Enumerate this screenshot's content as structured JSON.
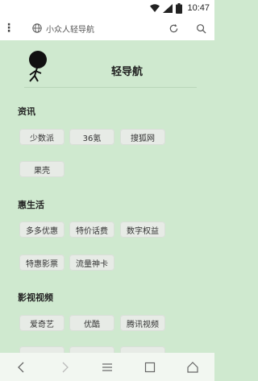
{
  "status_bar": {
    "time": "10:47"
  },
  "address_bar": {
    "url_text": "小众人轻导航"
  },
  "site": {
    "title": "轻导航"
  },
  "sections": [
    {
      "title": "资讯",
      "items": [
        "少数派",
        "36氪",
        "搜狐网",
        "果壳"
      ]
    },
    {
      "title": "惠生活",
      "items": [
        "多多优惠",
        "特价话费",
        "数字权益",
        "特惠影票",
        "流量神卡"
      ]
    },
    {
      "title": "影视视频",
      "items": [
        "爱奇艺",
        "优酷",
        "腾讯视频"
      ]
    }
  ],
  "icons": {
    "menu": "more-vert-icon",
    "site": "globe-icon",
    "reload": "refresh-icon",
    "search": "search-icon",
    "back": "back-icon",
    "forward": "forward-icon",
    "tabs-menu": "menu-icon",
    "tabs": "tabs-icon",
    "home": "home-icon"
  },
  "colors": {
    "page_bg": "#cfe9cf",
    "chip_bg": "#e7ebe6"
  }
}
